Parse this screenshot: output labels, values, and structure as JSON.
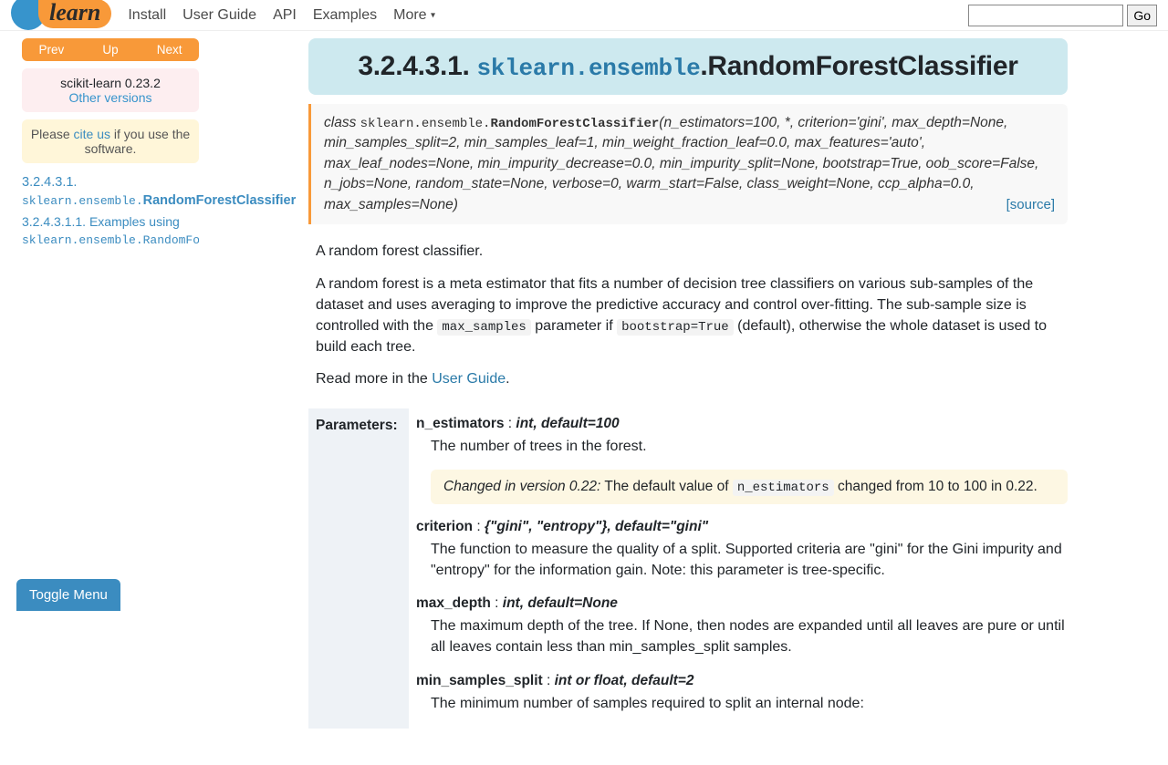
{
  "nav": {
    "install": "Install",
    "user_guide": "User Guide",
    "api": "API",
    "examples": "Examples",
    "more": "More",
    "go": "Go"
  },
  "sidebar": {
    "prev": "Prev",
    "up": "Up",
    "next": "Next",
    "version": "scikit-learn 0.23.2",
    "other_versions": "Other versions",
    "cite_pre": "Please ",
    "cite": "cite us",
    "cite_post": " if you use the software.",
    "toc_num": "3.2.4.3.1. ",
    "toc_mod": "sklearn.ensemble.",
    "toc_cls": "RandomForestClassifier",
    "toc_sub_num": "3.2.4.3.1.1. Examples using ",
    "toc_sub_mod": "sklearn.ensemble.RandomForestCl",
    "toggle": "Toggle Menu"
  },
  "title": {
    "num": "3.2.4.3.1. ",
    "mod": "sklearn.ensemble",
    "dot": ".",
    "cls": "RandomForestClassifier"
  },
  "sig": {
    "kw": "class ",
    "mod": "sklearn.ensemble.",
    "name": "RandomForestClassifier",
    "params": "(n_estimators=100, *, criterion='gini', max_depth=None, min_samples_split=2, min_samples_leaf=1, min_weight_fraction_leaf=0.0, max_features='auto', max_leaf_nodes=None, min_impurity_decrease=0.0, min_impurity_split=None, bootstrap=True, oob_score=False, n_jobs=None, random_state=None, verbose=0, warm_start=False, class_weight=None, ccp_alpha=0.0, max_samples=None)",
    "source": "[source]"
  },
  "body": {
    "p1": "A random forest classifier.",
    "p2a": "A random forest is a meta estimator that fits a number of decision tree classifiers on various sub-samples of the dataset and uses averaging to improve the predictive accuracy and control over-fitting. The sub-sample size is controlled with the ",
    "p2code1": "max_samples",
    "p2b": " parameter if ",
    "p2code2": "bootstrap=True",
    "p2c": " (default), otherwise the whole dataset is used to build each tree.",
    "p3a": "Read more in the ",
    "p3link": "User Guide",
    "p3b": "."
  },
  "params_label": "Parameters:",
  "params": [
    {
      "name": "n_estimators",
      "type": "int, default=100",
      "desc": "The number of trees in the forest.",
      "note_label": "Changed in version 0.22:",
      "note_a": " The default value of ",
      "note_code": "n_estimators",
      "note_b": " changed from 10 to 100 in 0.22."
    },
    {
      "name": "criterion",
      "type": "{\"gini\", \"entropy\"}, default=\"gini\"",
      "desc": "The function to measure the quality of a split. Supported criteria are \"gini\" for the Gini impurity and \"entropy\" for the information gain. Note: this parameter is tree-specific."
    },
    {
      "name": "max_depth",
      "type": "int, default=None",
      "desc": "The maximum depth of the tree. If None, then nodes are expanded until all leaves are pure or until all leaves contain less than min_samples_split samples."
    },
    {
      "name": "min_samples_split",
      "type": "int or float, default=2",
      "desc": "The minimum number of samples required to split an internal node:"
    }
  ]
}
